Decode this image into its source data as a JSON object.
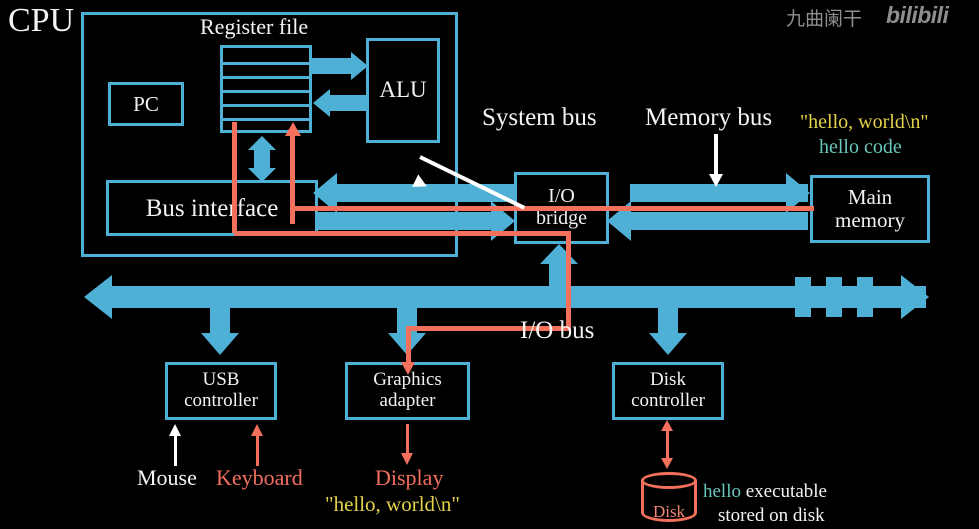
{
  "diagram": {
    "title": "CPU",
    "watermark_text": "九曲阑干",
    "watermark_logo": "bilibili",
    "colors": {
      "bus_blue": "#4fb0d6",
      "path_red": "#f2705c",
      "text_white": "#f4f4f4",
      "string_yellow": "#e3d24a",
      "code_teal": "#69c6bb",
      "background": "#000000"
    }
  },
  "cpu": {
    "label": "CPU",
    "register_file_label": "Register file",
    "register_file_rows": 6,
    "pc_label": "PC",
    "alu_label": "ALU",
    "bus_interface_label": "Bus interface"
  },
  "buses": {
    "system_bus_label": "System bus",
    "memory_bus_label": "Memory bus",
    "io_bus_label": "I/O bus",
    "io_bus_break_ticks": 3
  },
  "components": {
    "io_bridge_line1": "I/O",
    "io_bridge_line2": "bridge",
    "main_memory_line1": "Main",
    "main_memory_line2": "memory",
    "usb_controller_line1": "USB",
    "usb_controller_line2": "controller",
    "graphics_adapter_line1": "Graphics",
    "graphics_adapter_line2": "adapter",
    "disk_controller_line1": "Disk",
    "disk_controller_line2": "controller",
    "disk_label": "Disk"
  },
  "annotations": {
    "memory_string": "\"hello, world\\n\"",
    "memory_code": "hello code",
    "mouse_label": "Mouse",
    "keyboard_label": "Keyboard",
    "display_label": "Display",
    "display_string": "\"hello, world\\n\"",
    "disk_note_highlight": "hello",
    "disk_note_line1_rest": " executable",
    "disk_note_line2": "stored on disk"
  }
}
